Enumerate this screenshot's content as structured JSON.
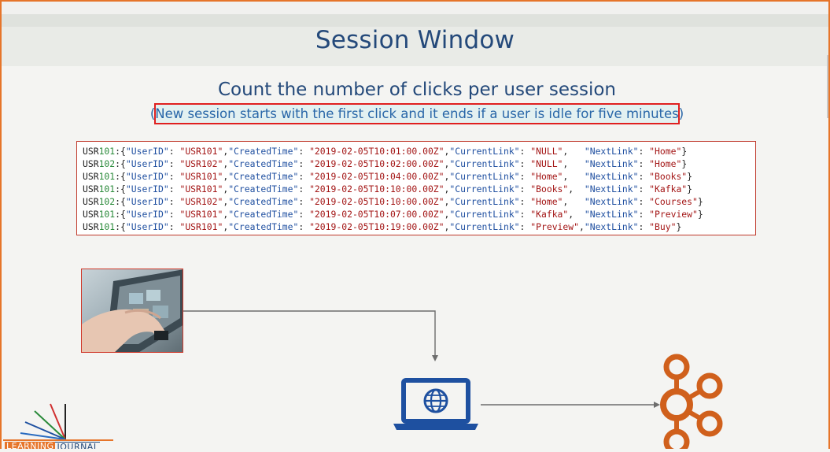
{
  "slide": {
    "title": "Session Window",
    "subtitle": "Count the number of clicks per user session",
    "note": "(New session starts with the first click and it ends if a user is idle for five minutes)"
  },
  "records": [
    {
      "prefix": "USR",
      "num": "101",
      "user": "\"USR101\"",
      "time": "\"2019-02-05T10:01:00.00Z\"",
      "current": "\"NULL\"",
      "sep": ",   ",
      "next": "\"Home\""
    },
    {
      "prefix": "USR",
      "num": "102",
      "user": "\"USR102\"",
      "time": "\"2019-02-05T10:02:00.00Z\"",
      "current": "\"NULL\"",
      "sep": ",   ",
      "next": "\"Home\""
    },
    {
      "prefix": "USR",
      "num": "101",
      "user": "\"USR101\"",
      "time": "\"2019-02-05T10:04:00.00Z\"",
      "current": "\"Home\"",
      "sep": ",   ",
      "next": "\"Books\""
    },
    {
      "prefix": "USR",
      "num": "101",
      "user": "\"USR101\"",
      "time": "\"2019-02-05T10:10:00.00Z\"",
      "current": "\"Books\"",
      "sep": ",  ",
      "next": "\"Kafka\""
    },
    {
      "prefix": "USR",
      "num": "102",
      "user": "\"USR102\"",
      "time": "\"2019-02-05T10:10:00.00Z\"",
      "current": "\"Home\"",
      "sep": ",   ",
      "next": "\"Courses\""
    },
    {
      "prefix": "USR",
      "num": "101",
      "user": "\"USR101\"",
      "time": "\"2019-02-05T10:07:00.00Z\"",
      "current": "\"Kafka\"",
      "sep": ",  ",
      "next": "\"Preview\""
    },
    {
      "prefix": "USR",
      "num": "101",
      "user": "\"USR101\"",
      "time": "\"2019-02-05T10:19:00.00Z\"",
      "current": "\"Preview\"",
      "sep": ",",
      "next": "\"Buy\""
    }
  ],
  "keys": {
    "user": "\"UserID\"",
    "time": "\"CreatedTime\"",
    "current": "\"CurrentLink\"",
    "next": "\"NextLink\""
  },
  "logo": {
    "part1": "LEARNING",
    "part2": "JOURNAL"
  },
  "icons": {
    "user_photo": "hand-on-tablet-photo",
    "web_server": "laptop-globe-icon",
    "broker": "kafka-logo-icon"
  },
  "colors": {
    "title": "#24497a",
    "accent": "#e6752a",
    "highlight_border": "#e02020",
    "icon_blue": "#1e50a0",
    "kafka_orange": "#d0601c"
  }
}
